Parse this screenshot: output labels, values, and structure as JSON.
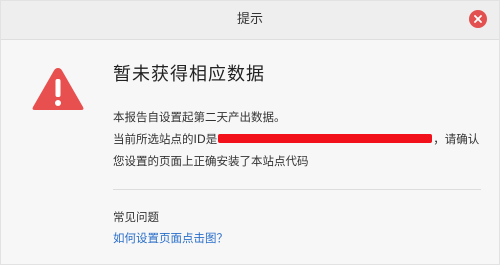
{
  "dialog": {
    "title": "提示",
    "heading": "暂未获得相应数据",
    "body": {
      "line1": "本报告自设置起第二天产出数据。",
      "line2_prefix": "当前所选站点的ID是",
      "line2_suffix": "，请确认",
      "line3": "您设置的页面上正确安装了本站点代码"
    },
    "faq": {
      "title": "常见问题",
      "link": "如何设置页面点击图？"
    }
  },
  "icons": {
    "close": "close-icon",
    "warning": "warning-triangle-icon"
  },
  "colors": {
    "warning": "#e84f4f",
    "close": "#e2504f",
    "link": "#2a6fc9",
    "redaction": "#f2101a"
  }
}
